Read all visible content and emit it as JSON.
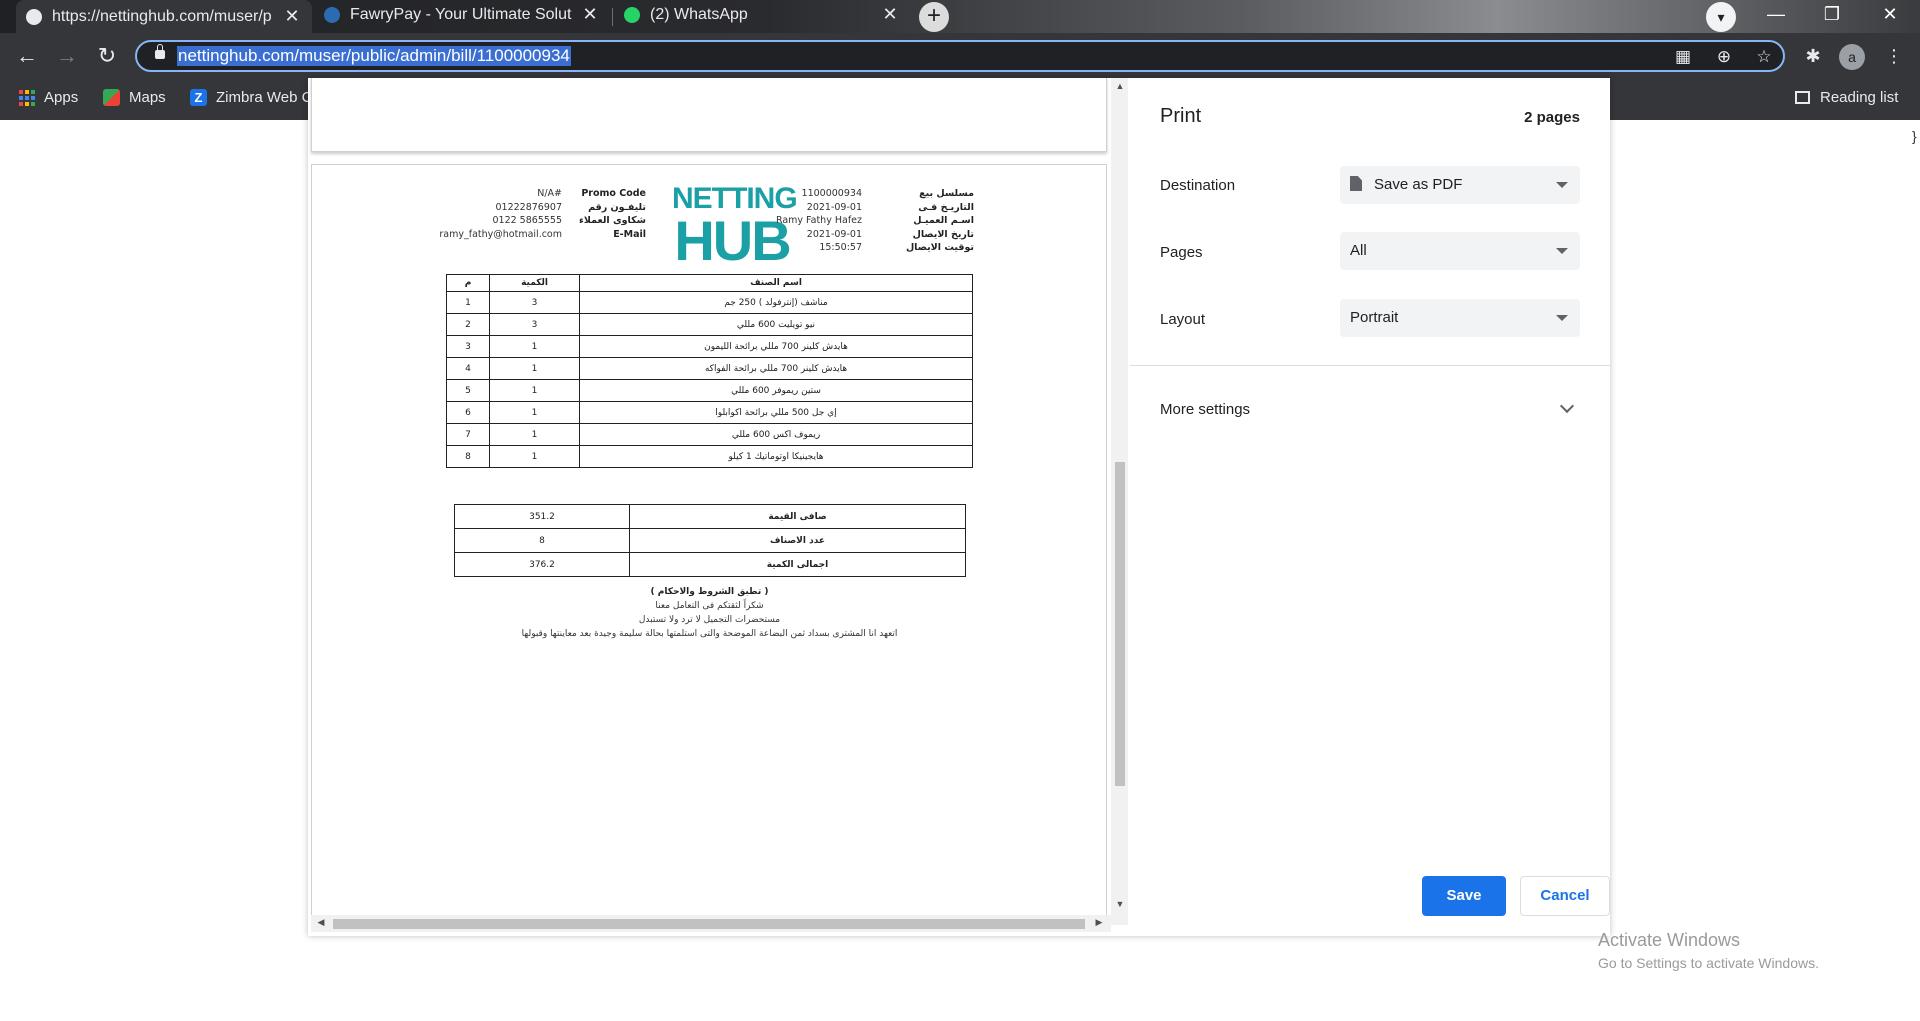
{
  "browser": {
    "tabs": [
      {
        "title": "https://nettinghub.com/muser/p",
        "active": true
      },
      {
        "title": "FawryPay - Your Ultimate Solutio",
        "active": false
      },
      {
        "title": "(2) WhatsApp",
        "active": false
      }
    ],
    "url": "nettinghub.com/muser/public/admin/bill/1100000934",
    "profile_initial": "a",
    "bookmarks": [
      "Apps",
      "Maps",
      "Zimbra Web C"
    ],
    "reading_list": "Reading list"
  },
  "invoice": {
    "logo_line1": "NETTING",
    "logo_line2": "HUB",
    "right_labels": [
      "مسلسل بيع",
      "التاريـخ فـى",
      "اسـم العميـل",
      "تاريخ الايصال",
      "توقيت الايصال"
    ],
    "right_values": [
      "1100000934",
      "2021-09-01",
      "Ramy Fathy Hafez",
      "2021-09-01",
      "15:50:57"
    ],
    "left_labels": [
      "Promo Code",
      "تليفـون رقم",
      "شكاوى العملاء",
      "E-Mail"
    ],
    "left_values": [
      "N/A#",
      "01222876907",
      "0122 5865555",
      "ramy_fathy@hotmail.com"
    ],
    "headers": {
      "num": "م",
      "qty": "الكمية",
      "name": "اسم الصنف"
    },
    "items": [
      {
        "num": "1",
        "qty": "3",
        "name": "مناشف (إنترفولد ) 250 جم"
      },
      {
        "num": "2",
        "qty": "3",
        "name": "نيو تويليت 600 مللي"
      },
      {
        "num": "3",
        "qty": "1",
        "name": "هايدش كلينر 700 مللي برائحة الليمون"
      },
      {
        "num": "4",
        "qty": "1",
        "name": "هايدش كلينر 700 مللي برائحة الفواكه"
      },
      {
        "num": "5",
        "qty": "1",
        "name": "ستين ريموفر 600 مللي"
      },
      {
        "num": "6",
        "qty": "1",
        "name": "إي جل 500 مللي برائحة اكوابلوا"
      },
      {
        "num": "7",
        "qty": "1",
        "name": "ريموف اكس 600 مللي"
      },
      {
        "num": "8",
        "qty": "1",
        "name": "هايجينيكا اوتوماتيك 1 كيلو"
      }
    ],
    "summary": [
      {
        "label": "صافى القيمة",
        "value": "351.2"
      },
      {
        "label": "عدد الاصناف",
        "value": "8"
      },
      {
        "label": "اجمالى الكمية",
        "value": "376.2"
      }
    ],
    "terms": [
      "( تطبق الشروط والاحكام )",
      "شكراً لثقتكم فى التعامل معنا",
      "مستحضرات التجميل لا ترد ولا تستبدل",
      "اتعهد انا المشترى بسداد ثمن البضاعة الموضحة والتى استلمتها بحالة سليمة وجيدة بعد معاينتها وقبولها"
    ]
  },
  "print": {
    "title": "Print",
    "page_count": "2 pages",
    "destination_label": "Destination",
    "destination_value": "Save as PDF",
    "pages_label": "Pages",
    "pages_value": "All",
    "layout_label": "Layout",
    "layout_value": "Portrait",
    "more_settings": "More settings",
    "save": "Save",
    "cancel": "Cancel"
  },
  "watermark": {
    "line1": "Activate Windows",
    "line2": "Go to Settings to activate Windows."
  }
}
